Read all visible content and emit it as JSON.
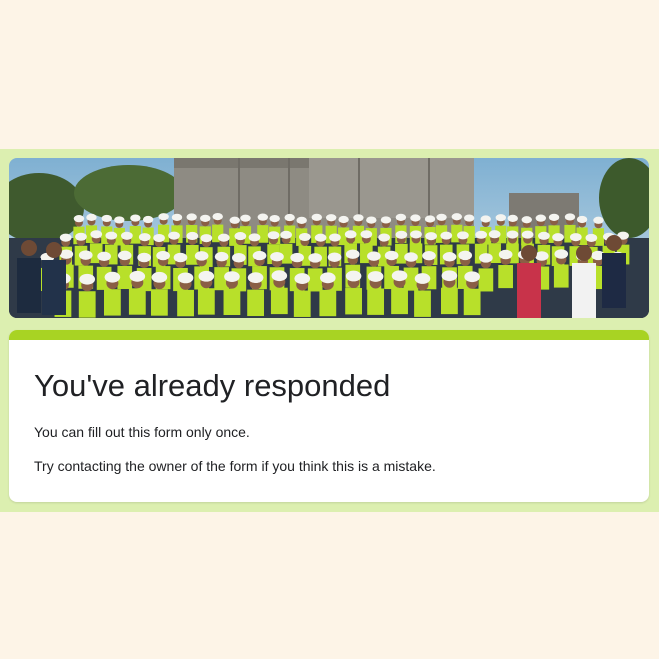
{
  "banner": {
    "image_name": "group-photo-hard-hats",
    "description_colors": {
      "sky": "#9ec3d9",
      "building": "#8c8a82",
      "vest": "#b8e02a",
      "helmet": "#f4f4f0"
    }
  },
  "form": {
    "accent_color": "#a8d323",
    "background_color": "#dcefb0",
    "title": "You've already responded",
    "message_once": "You can fill out this form only once.",
    "message_contact": "Try contacting the owner of the form if you think this is a mistake."
  }
}
